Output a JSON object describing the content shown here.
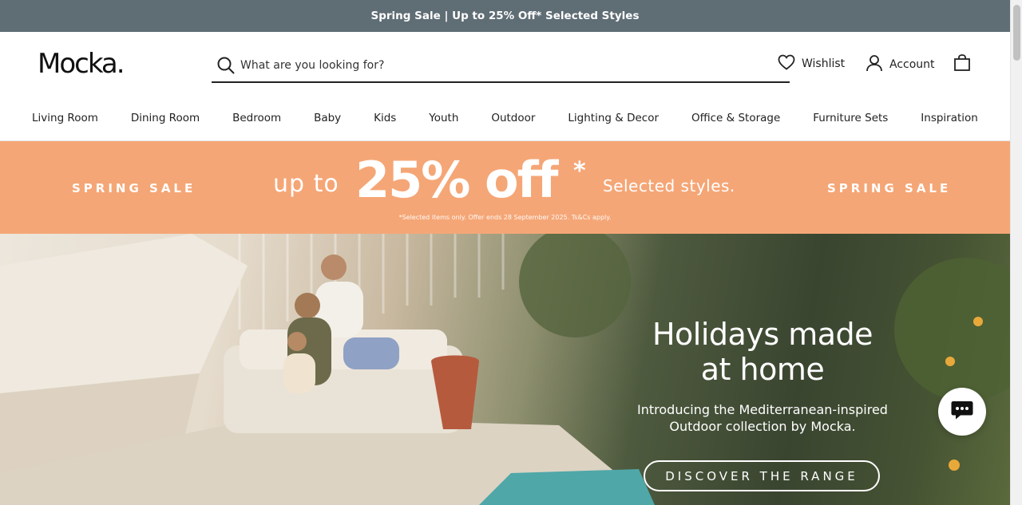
{
  "announcement": "Spring Sale | Up to 25% Off* Selected Styles",
  "header": {
    "logo": "Mocka.",
    "search_placeholder": "What are you looking for?",
    "wishlist": "Wishlist",
    "account": "Account"
  },
  "nav": [
    "Living Room",
    "Dining Room",
    "Bedroom",
    "Baby",
    "Kids",
    "Youth",
    "Outdoor",
    "Lighting & Decor",
    "Office & Storage",
    "Furniture Sets",
    "Inspiration"
  ],
  "promo": {
    "left": "SPRING SALE",
    "upto": "up to",
    "big": "25% off",
    "star": "*",
    "selected": "Selected styles.",
    "right": "SPRING SALE",
    "fine": "*Selected items only. Offer ends 28 September 2025. Ts&Cs apply."
  },
  "hero": {
    "title_line1": "Holidays made",
    "title_line2": "at home",
    "sub_line1": "Introducing the Mediterranean-inspired",
    "sub_line2": "Outdoor collection by Mocka.",
    "cta": "DISCOVER THE RANGE"
  },
  "colors": {
    "announcement_bg": "#5f6d75",
    "promo_bg": "#f5a676"
  }
}
